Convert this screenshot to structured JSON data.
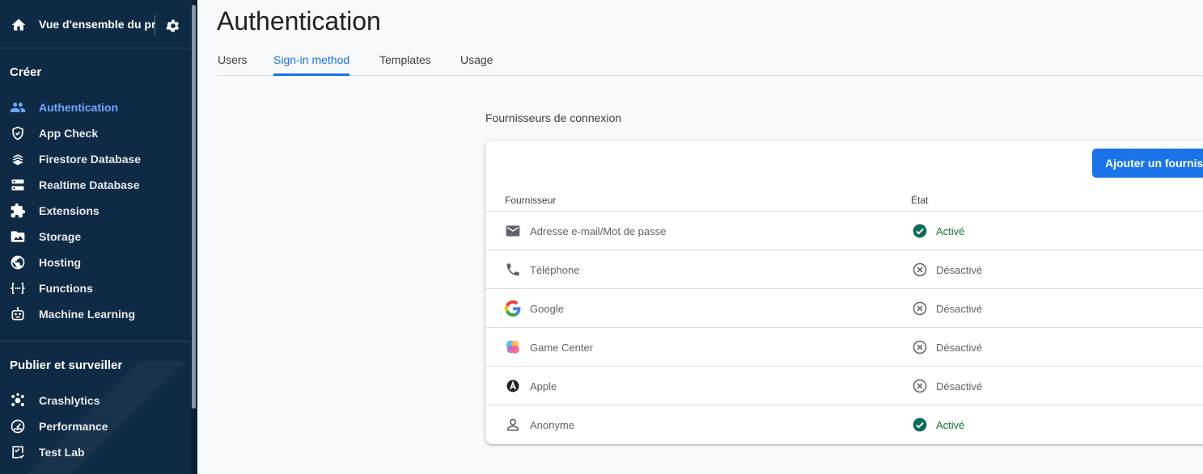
{
  "sidebar": {
    "project_name": "Vue d'ensemble du proj",
    "sections": [
      {
        "title": "Créer",
        "items": [
          {
            "label": "Authentication",
            "icon": "people-icon",
            "active": true
          },
          {
            "label": "App Check",
            "icon": "shield-icon"
          },
          {
            "label": "Firestore Database",
            "icon": "firestore-icon"
          },
          {
            "label": "Realtime Database",
            "icon": "database-icon"
          },
          {
            "label": "Extensions",
            "icon": "puzzle-icon"
          },
          {
            "label": "Storage",
            "icon": "image-folder-icon"
          },
          {
            "label": "Hosting",
            "icon": "globe-icon"
          },
          {
            "label": "Functions",
            "icon": "functions-icon"
          },
          {
            "label": "Machine Learning",
            "icon": "robot-icon"
          }
        ]
      },
      {
        "title": "Publier et surveiller",
        "items": [
          {
            "label": "Crashlytics",
            "icon": "crashlytics-icon"
          },
          {
            "label": "Performance",
            "icon": "speedometer-icon"
          },
          {
            "label": "Test Lab",
            "icon": "checklist-icon"
          }
        ]
      }
    ]
  },
  "main": {
    "title": "Authentication",
    "tabs": [
      {
        "label": "Users"
      },
      {
        "label": "Sign-in method",
        "active": true
      },
      {
        "label": "Templates"
      },
      {
        "label": "Usage"
      }
    ],
    "providers_title": "Fournisseurs de connexion",
    "add_button_label": "Ajouter un fournisseur",
    "columns": {
      "provider": "Fournisseur",
      "status": "État"
    },
    "providers": [
      {
        "name": "Adresse e-mail/Mot de passe",
        "icon": "email-icon",
        "status": "Activé",
        "enabled": true
      },
      {
        "name": "Téléphone",
        "icon": "phone-icon",
        "status": "Désactivé",
        "enabled": false
      },
      {
        "name": "Google",
        "icon": "google-icon",
        "status": "Désactivé",
        "enabled": false
      },
      {
        "name": "Game Center",
        "icon": "game-center-icon",
        "status": "Désactivé",
        "enabled": false
      },
      {
        "name": "Apple",
        "icon": "apple-icon",
        "status": "Désactivé",
        "enabled": false
      },
      {
        "name": "Anonyme",
        "icon": "person-icon",
        "status": "Activé",
        "enabled": true
      }
    ]
  },
  "colors": {
    "sidebar_bg": "#0f2a44",
    "accent": "#1a73e8",
    "active_nav": "#6fa8ff",
    "enabled": "#137333",
    "disabled": "#5f6368"
  }
}
